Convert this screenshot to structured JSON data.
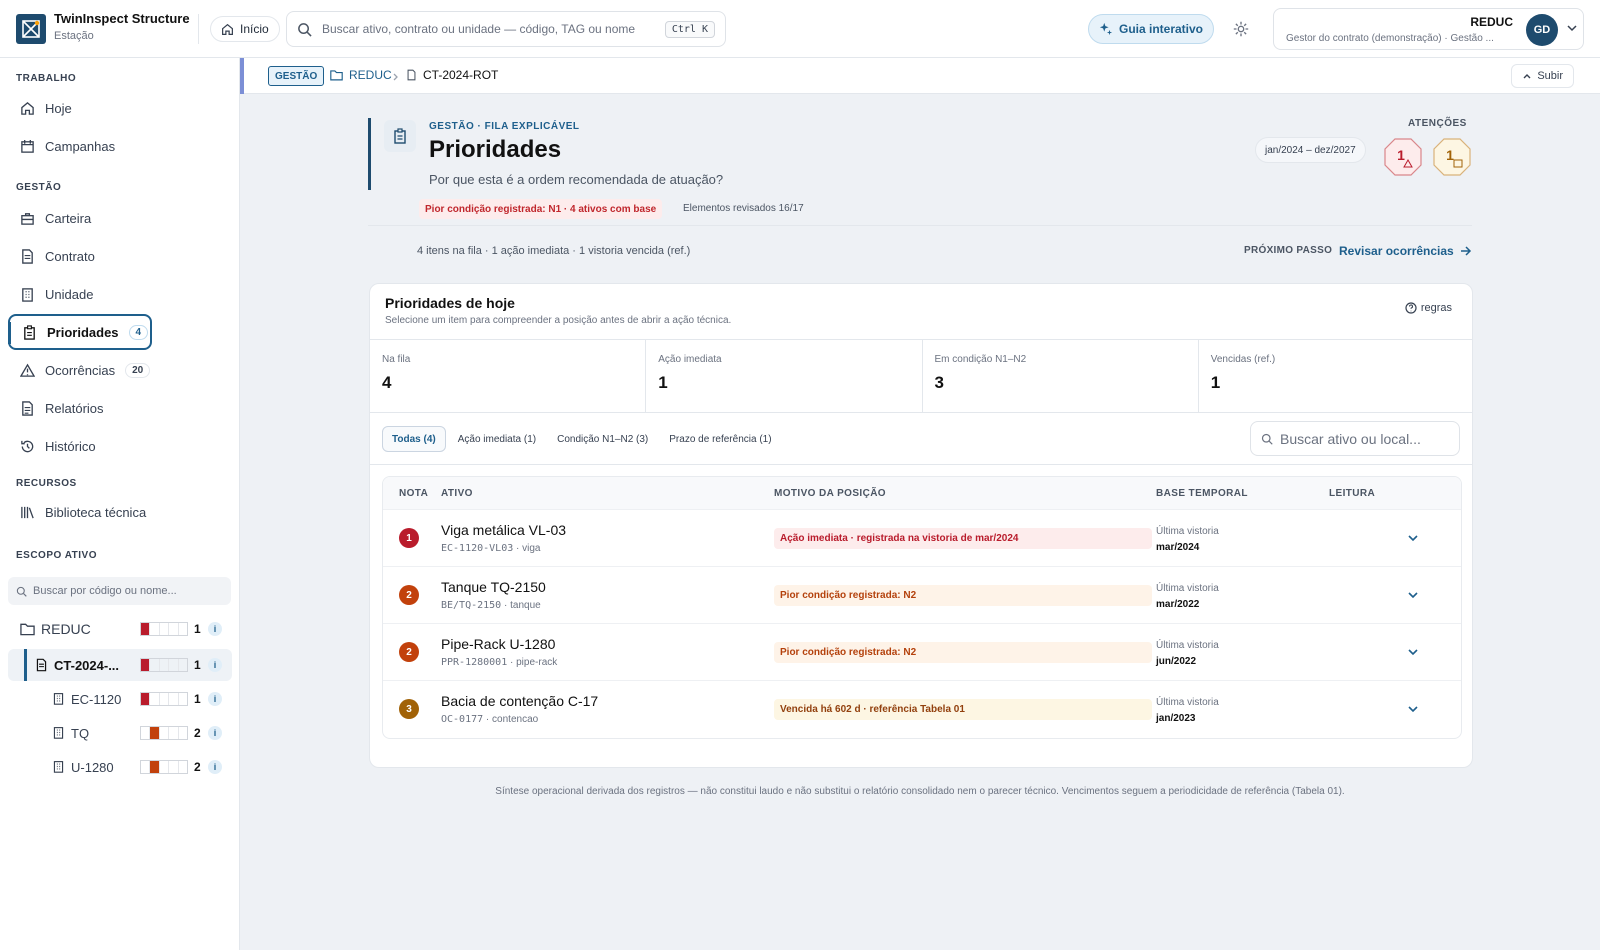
{
  "app": {
    "name": "TwinInspect  Structure",
    "subtitle": "Estação"
  },
  "topbar": {
    "home_label": "Início",
    "search_placeholder": "Buscar ativo, contrato ou unidade — código, TAG ou nome",
    "search_shortcut": "Ctrl K",
    "guide_label": "Guia interativo",
    "user_org": "REDUC",
    "user_role": "Gestor do contrato (demonstração) · Gestão ...",
    "user_initials": "GD"
  },
  "sidebar": {
    "sections": {
      "work": "TRABALHO",
      "management": "GESTÃO",
      "resources": "RECURSOS",
      "scope": "ESCOPO ATIVO"
    },
    "work_items": [
      {
        "label": "Hoje",
        "icon": "home-icon"
      },
      {
        "label": "Campanhas",
        "icon": "calendar-icon"
      }
    ],
    "management_items": [
      {
        "label": "Carteira",
        "icon": "briefcase-icon"
      },
      {
        "label": "Contrato",
        "icon": "document-icon"
      },
      {
        "label": "Unidade",
        "icon": "building-icon"
      },
      {
        "label": "Prioridades",
        "icon": "clipboard-icon",
        "count": "4",
        "active": true
      },
      {
        "label": "Ocorrências",
        "icon": "warning-icon",
        "count": "20"
      },
      {
        "label": "Relatórios",
        "icon": "report-icon"
      },
      {
        "label": "Histórico",
        "icon": "history-icon"
      }
    ],
    "resource_items": [
      {
        "label": "Biblioteca técnica",
        "icon": "library-icon"
      }
    ],
    "scope_search_placeholder": "Buscar por código ou nome...",
    "tree": [
      {
        "label": "REDUC",
        "count": "1",
        "level": "N1",
        "color": "#b91c2c"
      },
      {
        "label": "CT-2024-...",
        "count": "1",
        "level": "N1",
        "color": "#b91c2c"
      },
      {
        "label": "EC-1120",
        "count": "1",
        "level": "N1",
        "color": "#b91c2c"
      },
      {
        "label": "TQ",
        "count": "2",
        "level": "N2",
        "color": "#c2410c"
      },
      {
        "label": "U-1280",
        "count": "2",
        "level": "N2",
        "color": "#c2410c"
      }
    ],
    "info_glyph": "i"
  },
  "breadcrumb": {
    "tag": "GESTÃO",
    "org": "REDUC",
    "contract": "CT-2024-ROT",
    "up_label": "Subir"
  },
  "header": {
    "eyebrow": "GESTÃO · FILA EXPLICÁVEL",
    "title": "Prioridades",
    "subtitle": "Por que esta é a ordem recomendada de atuação?",
    "worst_condition": "Pior condição registrada: N1 · 4 ativos com base",
    "reviewed": "Elementos revisados 16/17",
    "attention_label": "ATENÇÕES",
    "period": "jan/2024 – dez/2027",
    "attention_counts": [
      "1",
      "1"
    ],
    "summary": "4 itens na fila · 1 ação imediata · 1 vistoria vencida (ref.)",
    "next_step_label": "PRÓXIMO PASSO",
    "next_step_action": "Revisar ocorrências"
  },
  "card": {
    "title": "Prioridades de hoje",
    "subtitle": "Selecione um item para compreender a posição antes de abrir a ação técnica.",
    "rules_label": "regras",
    "stats": [
      {
        "label": "Na fila",
        "value": "4"
      },
      {
        "label": "Ação imediata",
        "value": "1"
      },
      {
        "label": "Em condição N1–N2",
        "value": "3"
      },
      {
        "label": "Vencidas (ref.)",
        "value": "1"
      }
    ],
    "filters": [
      "Todas (4)",
      "Ação imediata (1)",
      "Condição N1–N2 (3)",
      "Prazo de referência (1)"
    ],
    "table_search_placeholder": "Buscar ativo ou local...",
    "columns": [
      "NOTA",
      "ATIVO",
      "MOTIVO DA POSIÇÃO",
      "BASE TEMPORAL",
      "LEITURA"
    ],
    "rows": [
      {
        "grade": "1",
        "grade_color": "#b91c2c",
        "name": "Viga metálica VL-03",
        "code": "EC-1120-VL03",
        "type": "viga",
        "reason": "Ação imediata · registrada na vistoria de mar/2024",
        "reason_bg": "#fdecec",
        "reason_fg": "#b91c2c",
        "time_label": "Última vistoria",
        "time_value": "mar/2024"
      },
      {
        "grade": "2",
        "grade_color": "#c2410c",
        "name": "Tanque TQ-2150",
        "code": "BE/TQ-2150",
        "type": "tanque",
        "reason": "Pior condição registrada: N2",
        "reason_bg": "#fef3e8",
        "reason_fg": "#b4410c",
        "time_label": "Última vistoria",
        "time_value": "mar/2022"
      },
      {
        "grade": "2",
        "grade_color": "#c2410c",
        "name": "Pipe-Rack U-1280",
        "code": "PPR-1280001",
        "type": "pipe-rack",
        "reason": "Pior condição registrada: N2",
        "reason_bg": "#fef3e8",
        "reason_fg": "#b4410c",
        "time_label": "Última vistoria",
        "time_value": "jun/2022"
      },
      {
        "grade": "3",
        "grade_color": "#a16207",
        "name": "Bacia de contenção C-17",
        "code": "OC-0177",
        "type": "contencao",
        "reason": "Vencida há 602 d · referência Tabela 01",
        "reason_bg": "#fdf6e3",
        "reason_fg": "#92400e",
        "time_label": "Última vistoria",
        "time_value": "jan/2023"
      }
    ]
  },
  "footnote": "Síntese operacional derivada dos registros — não constitui laudo e não substitui o relatório consolidado nem o parecer técnico. Vencimentos seguem a periodicidade de referência (Tabela 01)."
}
